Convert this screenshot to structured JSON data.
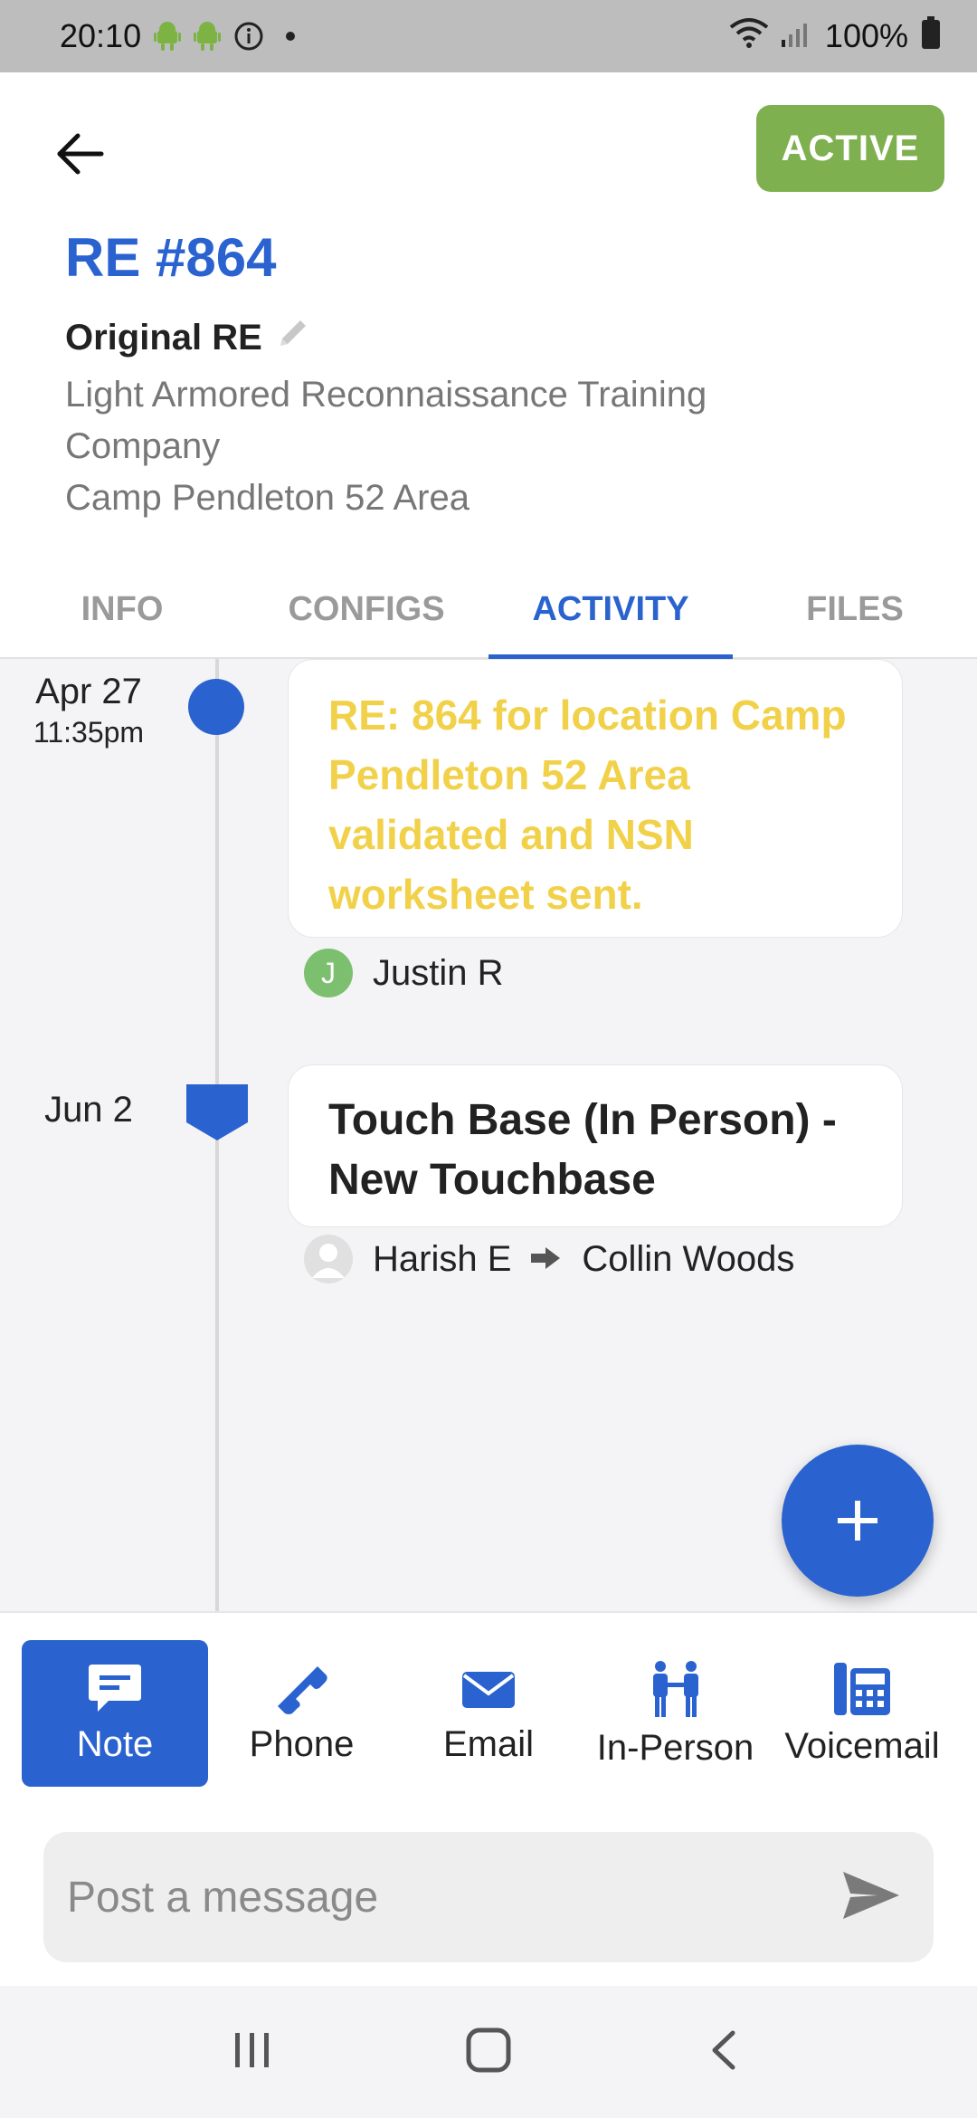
{
  "status_bar": {
    "time": "20:10",
    "battery": "100%"
  },
  "header": {
    "status_badge": "ACTIVE",
    "title": "RE #864",
    "subtitle": "Original RE",
    "description_line1": "Light Armored Reconnaissance Training",
    "description_line2": "Company",
    "location": "Camp Pendleton 52 Area"
  },
  "tabs": [
    {
      "label": "INFO",
      "active": false
    },
    {
      "label": "CONFIGS",
      "active": false
    },
    {
      "label": "ACTIVITY",
      "active": true
    },
    {
      "label": "FILES",
      "active": false
    }
  ],
  "timeline": [
    {
      "date": "Apr 27",
      "time": "11:35pm",
      "message": "RE: 864 for location Camp Pendleton 52 Area validated and NSN worksheet sent.",
      "author_initial": "J",
      "author": "Justin R"
    },
    {
      "date": "Jun 2",
      "message": "Touch Base (In Person) - New Touchbase",
      "author": "Harish E",
      "recipient": "Collin Woods"
    }
  ],
  "actions": [
    {
      "label": "Note",
      "icon": "note-icon",
      "selected": true
    },
    {
      "label": "Phone",
      "icon": "phone-icon",
      "selected": false
    },
    {
      "label": "Email",
      "icon": "email-icon",
      "selected": false
    },
    {
      "label": "In-Person",
      "icon": "in-person-icon",
      "selected": false
    },
    {
      "label": "Voicemail",
      "icon": "voicemail-icon",
      "selected": false
    }
  ],
  "composer": {
    "placeholder": "Post a message"
  },
  "colors": {
    "accent": "#2a63cf",
    "active_badge": "#7fb04f",
    "highlight_text": "#f2d14a"
  }
}
